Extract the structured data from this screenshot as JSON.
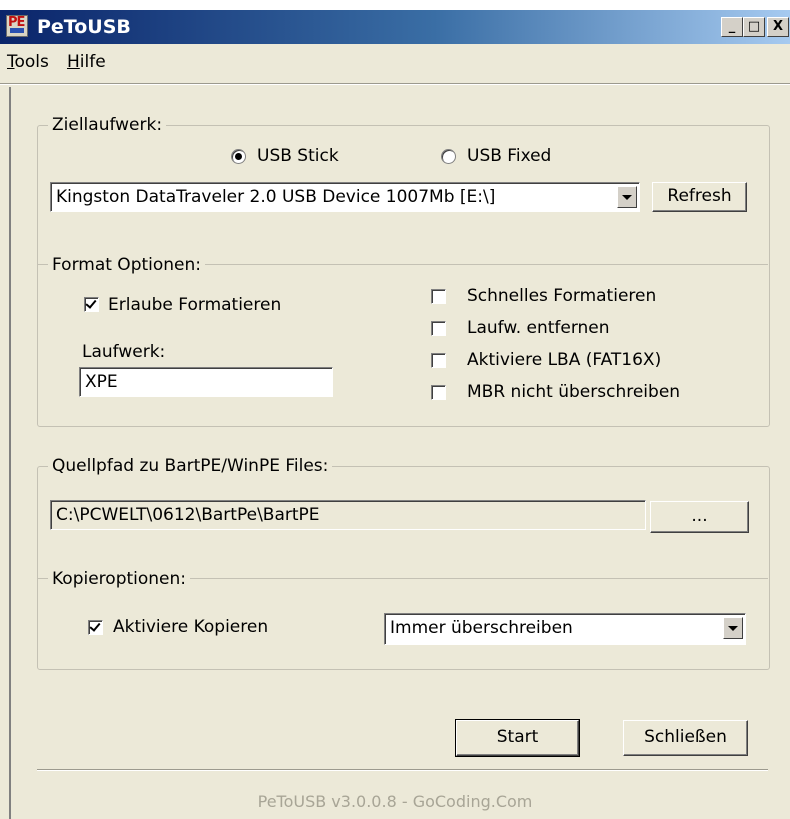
{
  "window": {
    "title": "PeToUSB",
    "icon_text": "PE",
    "minimize_label": "_",
    "maximize_label": "□",
    "close_label": "X"
  },
  "menu": {
    "tools_label_ul": "T",
    "tools_label_rest": "ools",
    "help_label_ul": "H",
    "help_label_rest": "ilfe"
  },
  "target": {
    "group_title": "Ziellaufwerk:",
    "radio_usb_stick": "USB Stick",
    "radio_usb_fixed": "USB Fixed",
    "selected": "usb_stick",
    "device_value": "Kingston DataTraveler 2.0 USB Device 1007Mb [E:\\]",
    "refresh_label": "Refresh"
  },
  "format": {
    "group_title": "Format Optionen:",
    "allow_format_label": "Erlaube Formatieren",
    "allow_format_checked": true,
    "drive_label": "Laufwerk:",
    "drive_value": "XPE",
    "quick_format_label": "Schnelles Formatieren",
    "quick_format_checked": false,
    "remove_drive_label": "Laufw. entfernen",
    "remove_drive_checked": false,
    "enable_lba_label": "Aktiviere LBA (FAT16X)",
    "enable_lba_checked": false,
    "no_mbr_label": "MBR nicht überschreiben",
    "no_mbr_checked": false
  },
  "source": {
    "group_title": "Quellpfad zu BartPE/WinPE Files:",
    "path_value": "C:\\PCWELT\\0612\\BartPe\\BartPE",
    "browse_label": "..."
  },
  "copy": {
    "group_title": "Kopieroptionen:",
    "enable_copy_label": "Aktiviere Kopieren",
    "enable_copy_checked": true,
    "overwrite_value": "Immer überschreiben"
  },
  "actions": {
    "start_label": "Start",
    "close_label": "Schließen"
  },
  "footer": {
    "text": "PeToUSB v3.0.0.8 - GoCoding.Com"
  },
  "colors": {
    "titlebar_start": "#0a246a",
    "titlebar_end": "#a6caf0",
    "dialog_bg": "#ece9d8"
  }
}
